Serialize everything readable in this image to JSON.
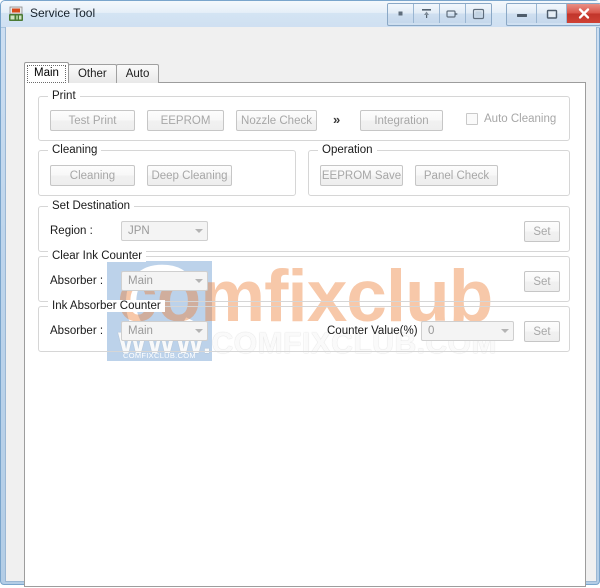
{
  "window": {
    "title": "Service Tool",
    "icon": "app-icon",
    "toolbar_buttons": [
      {
        "name": "stop-button",
        "glyph": "■"
      },
      {
        "name": "pin-button",
        "glyph": "⏏"
      },
      {
        "name": "dock-button",
        "glyph": "❐"
      },
      {
        "name": "restore-layout-button",
        "glyph": "□"
      }
    ],
    "controls": [
      {
        "name": "minimize-button",
        "label": "–"
      },
      {
        "name": "maximize-button",
        "label": "□"
      },
      {
        "name": "close-button",
        "label": "✕"
      }
    ]
  },
  "tabs": [
    {
      "label": "Main",
      "active": true
    },
    {
      "label": "Other",
      "active": false
    },
    {
      "label": "Auto",
      "active": false
    }
  ],
  "groups": {
    "print": {
      "label": "Print",
      "test_print": "Test Print",
      "eeprom": "EEPROM",
      "nozzle_check": "Nozzle Check",
      "chevron": "»",
      "integration": "Integration",
      "auto_cleaning": "Auto Cleaning",
      "auto_cleaning_checked": false
    },
    "cleaning": {
      "label": "Cleaning",
      "cleaning": "Cleaning",
      "deep_cleaning": "Deep Cleaning"
    },
    "operation": {
      "label": "Operation",
      "eeprom_save": "EEPROM Save",
      "panel_check": "Panel Check"
    },
    "set_destination": {
      "label": "Set Destination",
      "region_label": "Region :",
      "region_value": "JPN",
      "set": "Set"
    },
    "clear_ink_counter": {
      "label": "Clear Ink Counter",
      "absorber_label": "Absorber :",
      "absorber_value": "Main",
      "set": "Set"
    },
    "ink_absorber_counter": {
      "label": "Ink Absorber Counter",
      "absorber_label": "Absorber :",
      "absorber_value": "Main",
      "counter_value_label": "Counter Value(%) :",
      "counter_value": "0",
      "set": "Set"
    }
  },
  "watermark": {
    "logo_letter": "C",
    "logo_domain": "COMFIXCLUB.COM",
    "brand": "comfixclub",
    "url": "WWW.COMFIXCLUB.COM"
  },
  "colors": {
    "frame": "#b3cde6",
    "close": "#cf4235",
    "watermark_blue": "#bcd2ea",
    "watermark_orange": "#ed7d31"
  }
}
